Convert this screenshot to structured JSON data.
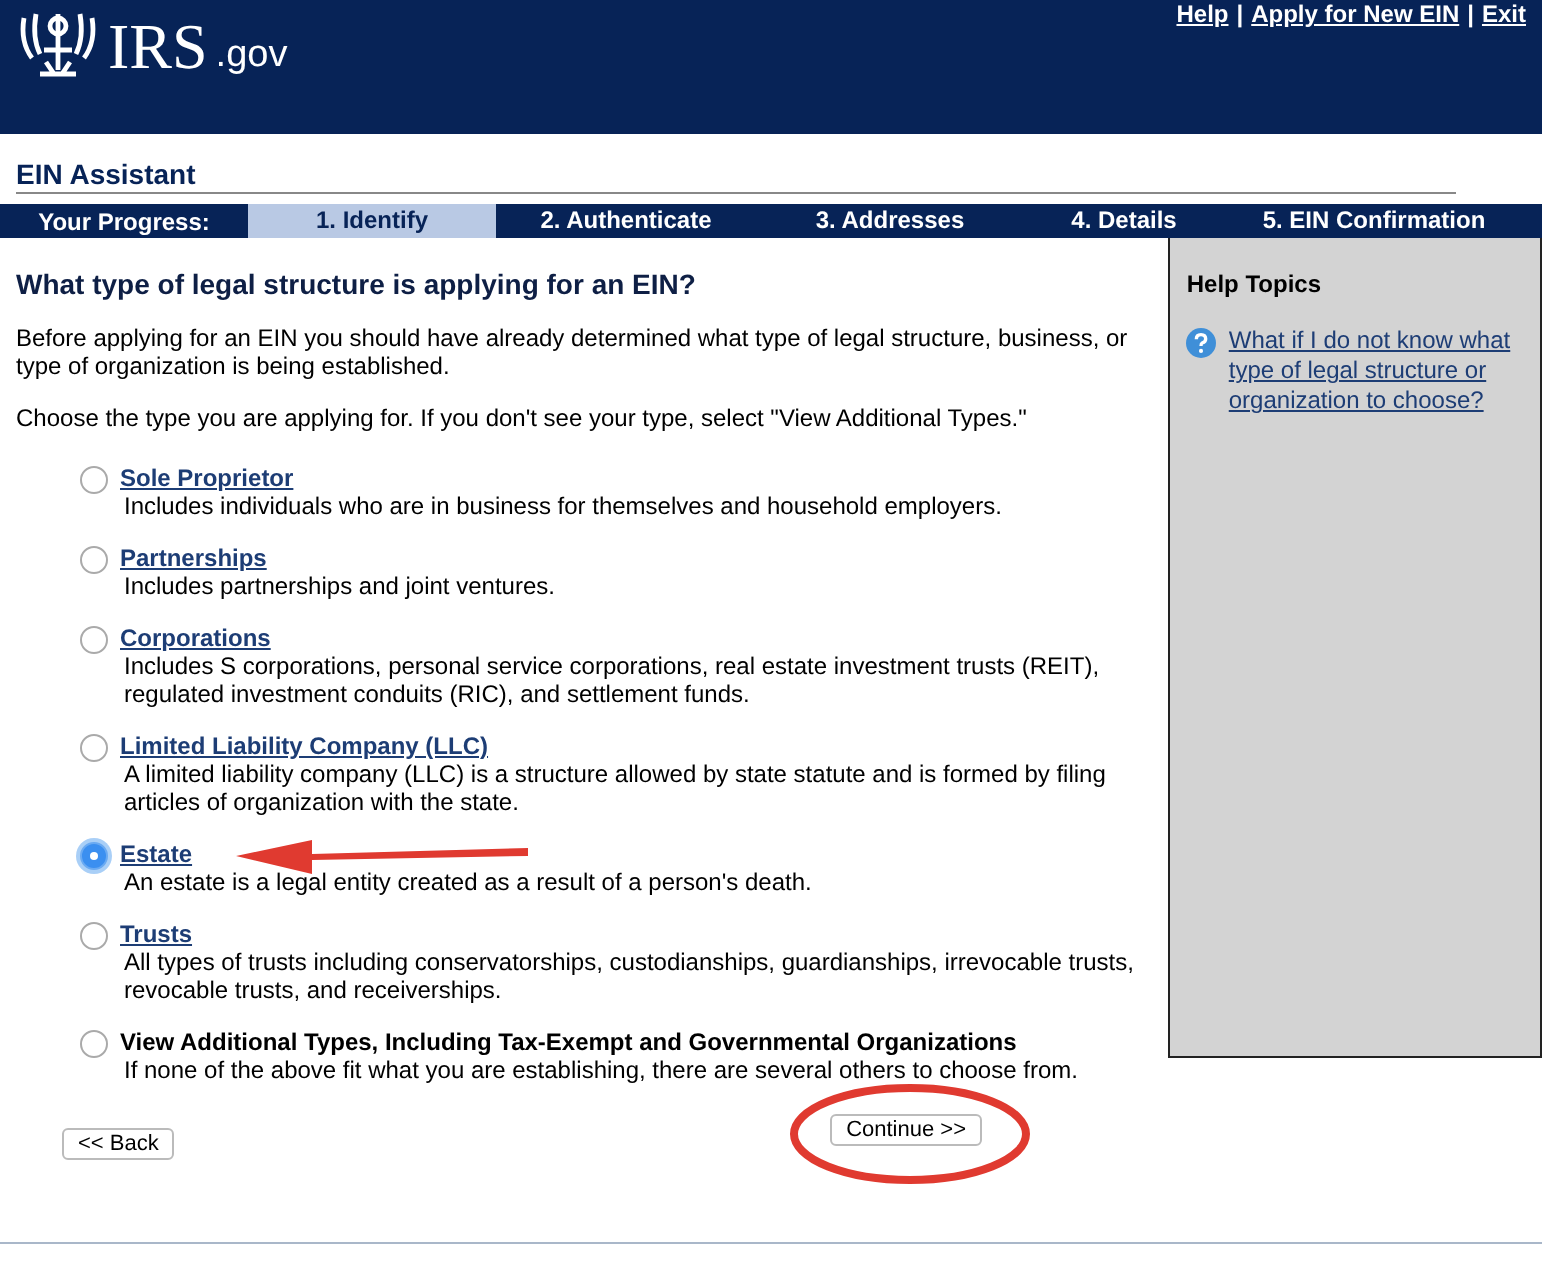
{
  "header": {
    "logo_text": "IRS",
    "logo_suffix": ".gov",
    "links": [
      "Help",
      "Apply for New EIN",
      "Exit"
    ],
    "separator": "|"
  },
  "assistant_title": "EIN Assistant",
  "progress": {
    "label": "Your Progress:",
    "steps": [
      {
        "label": "1. Identify",
        "selected": true
      },
      {
        "label": "2. Authenticate",
        "selected": false
      },
      {
        "label": "3. Addresses",
        "selected": false
      },
      {
        "label": "4. Details",
        "selected": false
      },
      {
        "label": "5. EIN Confirmation",
        "selected": false
      }
    ]
  },
  "question": "What type of legal structure is applying for an EIN?",
  "intro": [
    "Before applying for an EIN you should have already determined what type of legal structure, business, or type of organization is being established.",
    "Choose the type you are applying for. If you don't see your type, select \"View Additional Types.\""
  ],
  "options": [
    {
      "kind": "link",
      "label": "Sole Proprietor",
      "description": "Includes individuals who are in business for themselves and household employers.",
      "selected": false
    },
    {
      "kind": "link",
      "label": "Partnerships",
      "description": "Includes partnerships and joint ventures.",
      "selected": false
    },
    {
      "kind": "link",
      "label": "Corporations",
      "description": "Includes S corporations, personal service corporations, real estate investment trusts (REIT), regulated investment conduits (RIC), and settlement funds.",
      "selected": false
    },
    {
      "kind": "link",
      "label": "Limited Liability Company (LLC)",
      "description": "A limited liability company (LLC) is a structure allowed by state statute and is formed by filing articles of organization with the state.",
      "selected": false
    },
    {
      "kind": "link",
      "label": "Estate",
      "description": "An estate is a legal entity created as a result of a person's death.",
      "selected": true
    },
    {
      "kind": "link",
      "label": "Trusts",
      "description": "All types of trusts including conservatorships, custodianships, guardianships, irrevocable trusts, revocable trusts, and receiverships.",
      "selected": false
    },
    {
      "kind": "plain",
      "label": "View Additional Types, Including Tax-Exempt and Governmental Organizations",
      "description": "If none of the above fit what you are establishing, there are several others to choose from.",
      "selected": false
    }
  ],
  "help": {
    "title": "Help Topics",
    "links": [
      "What if I do not know what type of legal structure or organization to choose?"
    ]
  },
  "buttons": {
    "back": "<< Back",
    "continue": "Continue >>"
  }
}
